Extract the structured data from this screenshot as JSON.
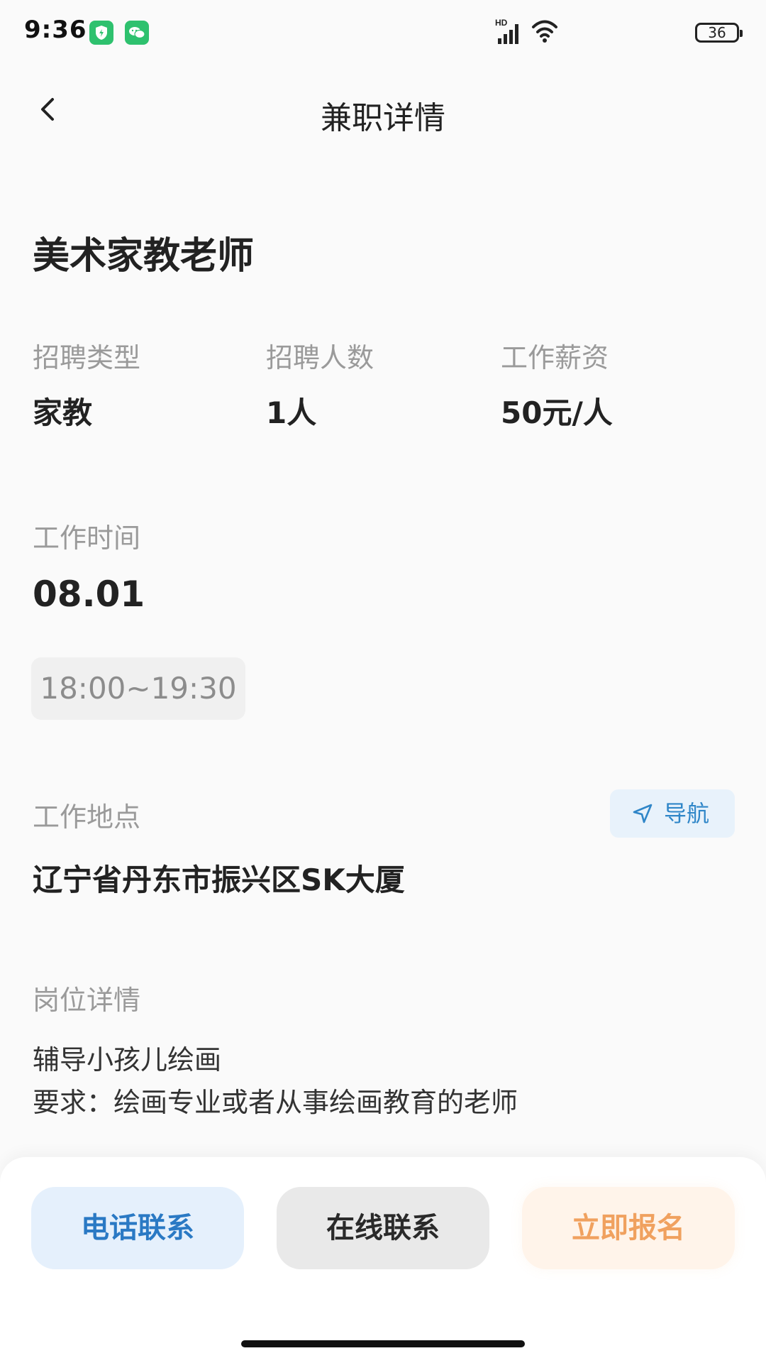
{
  "status_bar": {
    "time": "9:36",
    "network_label": "HD",
    "battery": "36",
    "icons": [
      "shield-app-icon",
      "wechat-icon",
      "signal-icon",
      "wifi-icon",
      "battery-icon"
    ]
  },
  "header": {
    "back_icon": "chevron-left-icon",
    "title": "兼职详情"
  },
  "job": {
    "title": "美术家教老师",
    "info": [
      {
        "label": "招聘类型",
        "value": "家教"
      },
      {
        "label": "招聘人数",
        "value": "1人"
      },
      {
        "label": "工作薪资",
        "value": "50元/人"
      }
    ],
    "time_label": "工作时间",
    "date": "08.01",
    "time_range": "18:00~19:30",
    "location_label": "工作地点",
    "nav_label": "导航",
    "address": "辽宁省丹东市振兴区SK大厦",
    "detail_label": "岗位详情",
    "details": [
      "辅导小孩儿绘画",
      "要求：绘画专业或者从事绘画教育的老师"
    ]
  },
  "actions": {
    "phone": "电话联系",
    "online": "在线联系",
    "signup": "立即报名"
  },
  "colors": {
    "accent_blue": "#2a79c4",
    "signup_orange": "#f0a15f",
    "label_gray": "#9a9a9a"
  }
}
